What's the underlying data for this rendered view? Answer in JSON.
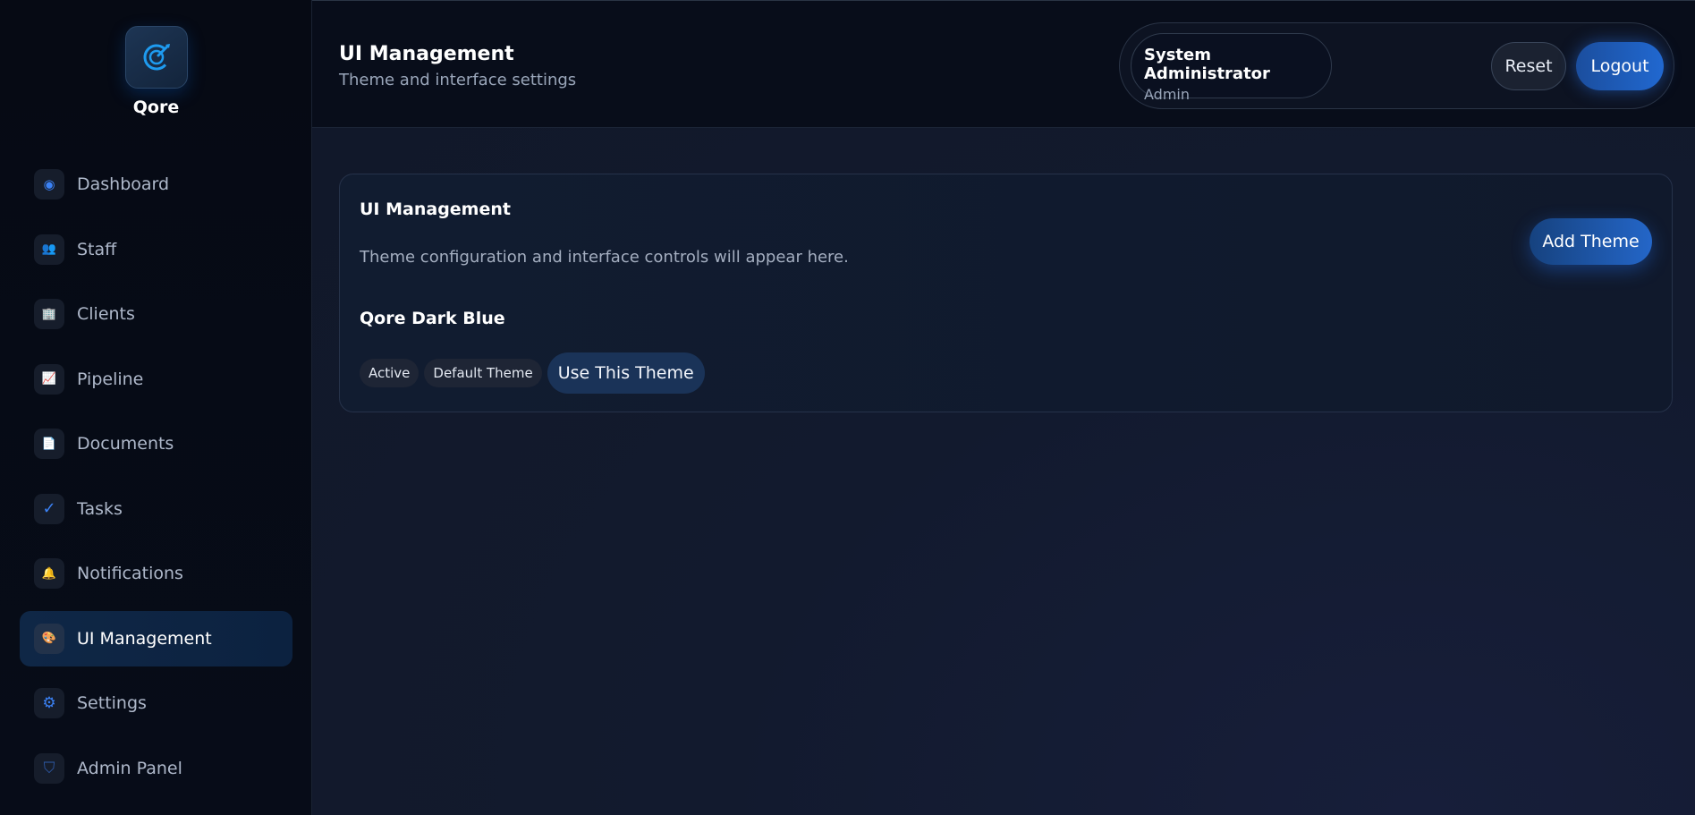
{
  "brand": {
    "name": "Qore",
    "logo_icon": "compass-logo-icon"
  },
  "sidebar": {
    "items": [
      {
        "label": "Dashboard",
        "icon": "dashboard-dot-icon",
        "glyph": "◉",
        "color": "#3b82f6"
      },
      {
        "label": "Staff",
        "icon": "people-icon",
        "glyph": "👥",
        "color": "#7c5cd6"
      },
      {
        "label": "Clients",
        "icon": "building-icon",
        "glyph": "🏢",
        "color": "#8aa4c8"
      },
      {
        "label": "Pipeline",
        "icon": "chart-increasing-icon",
        "glyph": "📈",
        "color": "#e05a7a"
      },
      {
        "label": "Documents",
        "icon": "document-icon",
        "glyph": "📄",
        "color": "#e6e6e6"
      },
      {
        "label": "Tasks",
        "icon": "checkmark-icon",
        "glyph": "✓",
        "color": "#3b82f6"
      },
      {
        "label": "Notifications",
        "icon": "bell-icon",
        "glyph": "🔔",
        "color": "#f5b82e"
      },
      {
        "label": "UI Management",
        "icon": "palette-icon",
        "glyph": "🎨",
        "color": "#f0a0a0",
        "active": true
      },
      {
        "label": "Settings",
        "icon": "gear-icon",
        "glyph": "⚙",
        "color": "#3b82f6"
      },
      {
        "label": "Admin Panel",
        "icon": "shield-icon",
        "glyph": "⛉",
        "color": "#2e5aa8"
      }
    ]
  },
  "header": {
    "title": "UI Management",
    "subtitle": "Theme and interface settings",
    "user": {
      "name": "System Administrator",
      "role": "Admin"
    },
    "reset_label": "Reset",
    "logout_label": "Logout"
  },
  "card": {
    "title": "UI Management",
    "description": "Theme configuration and interface controls will appear here.",
    "add_theme_label": "Add Theme",
    "theme": {
      "name": "Qore Dark Blue",
      "badges": [
        "Active",
        "Default Theme"
      ],
      "use_label": "Use This Theme"
    }
  },
  "colors": {
    "accent": "#2168d0",
    "sidebar_bg": "#060a14",
    "active_nav_bg": "#0f2746"
  }
}
